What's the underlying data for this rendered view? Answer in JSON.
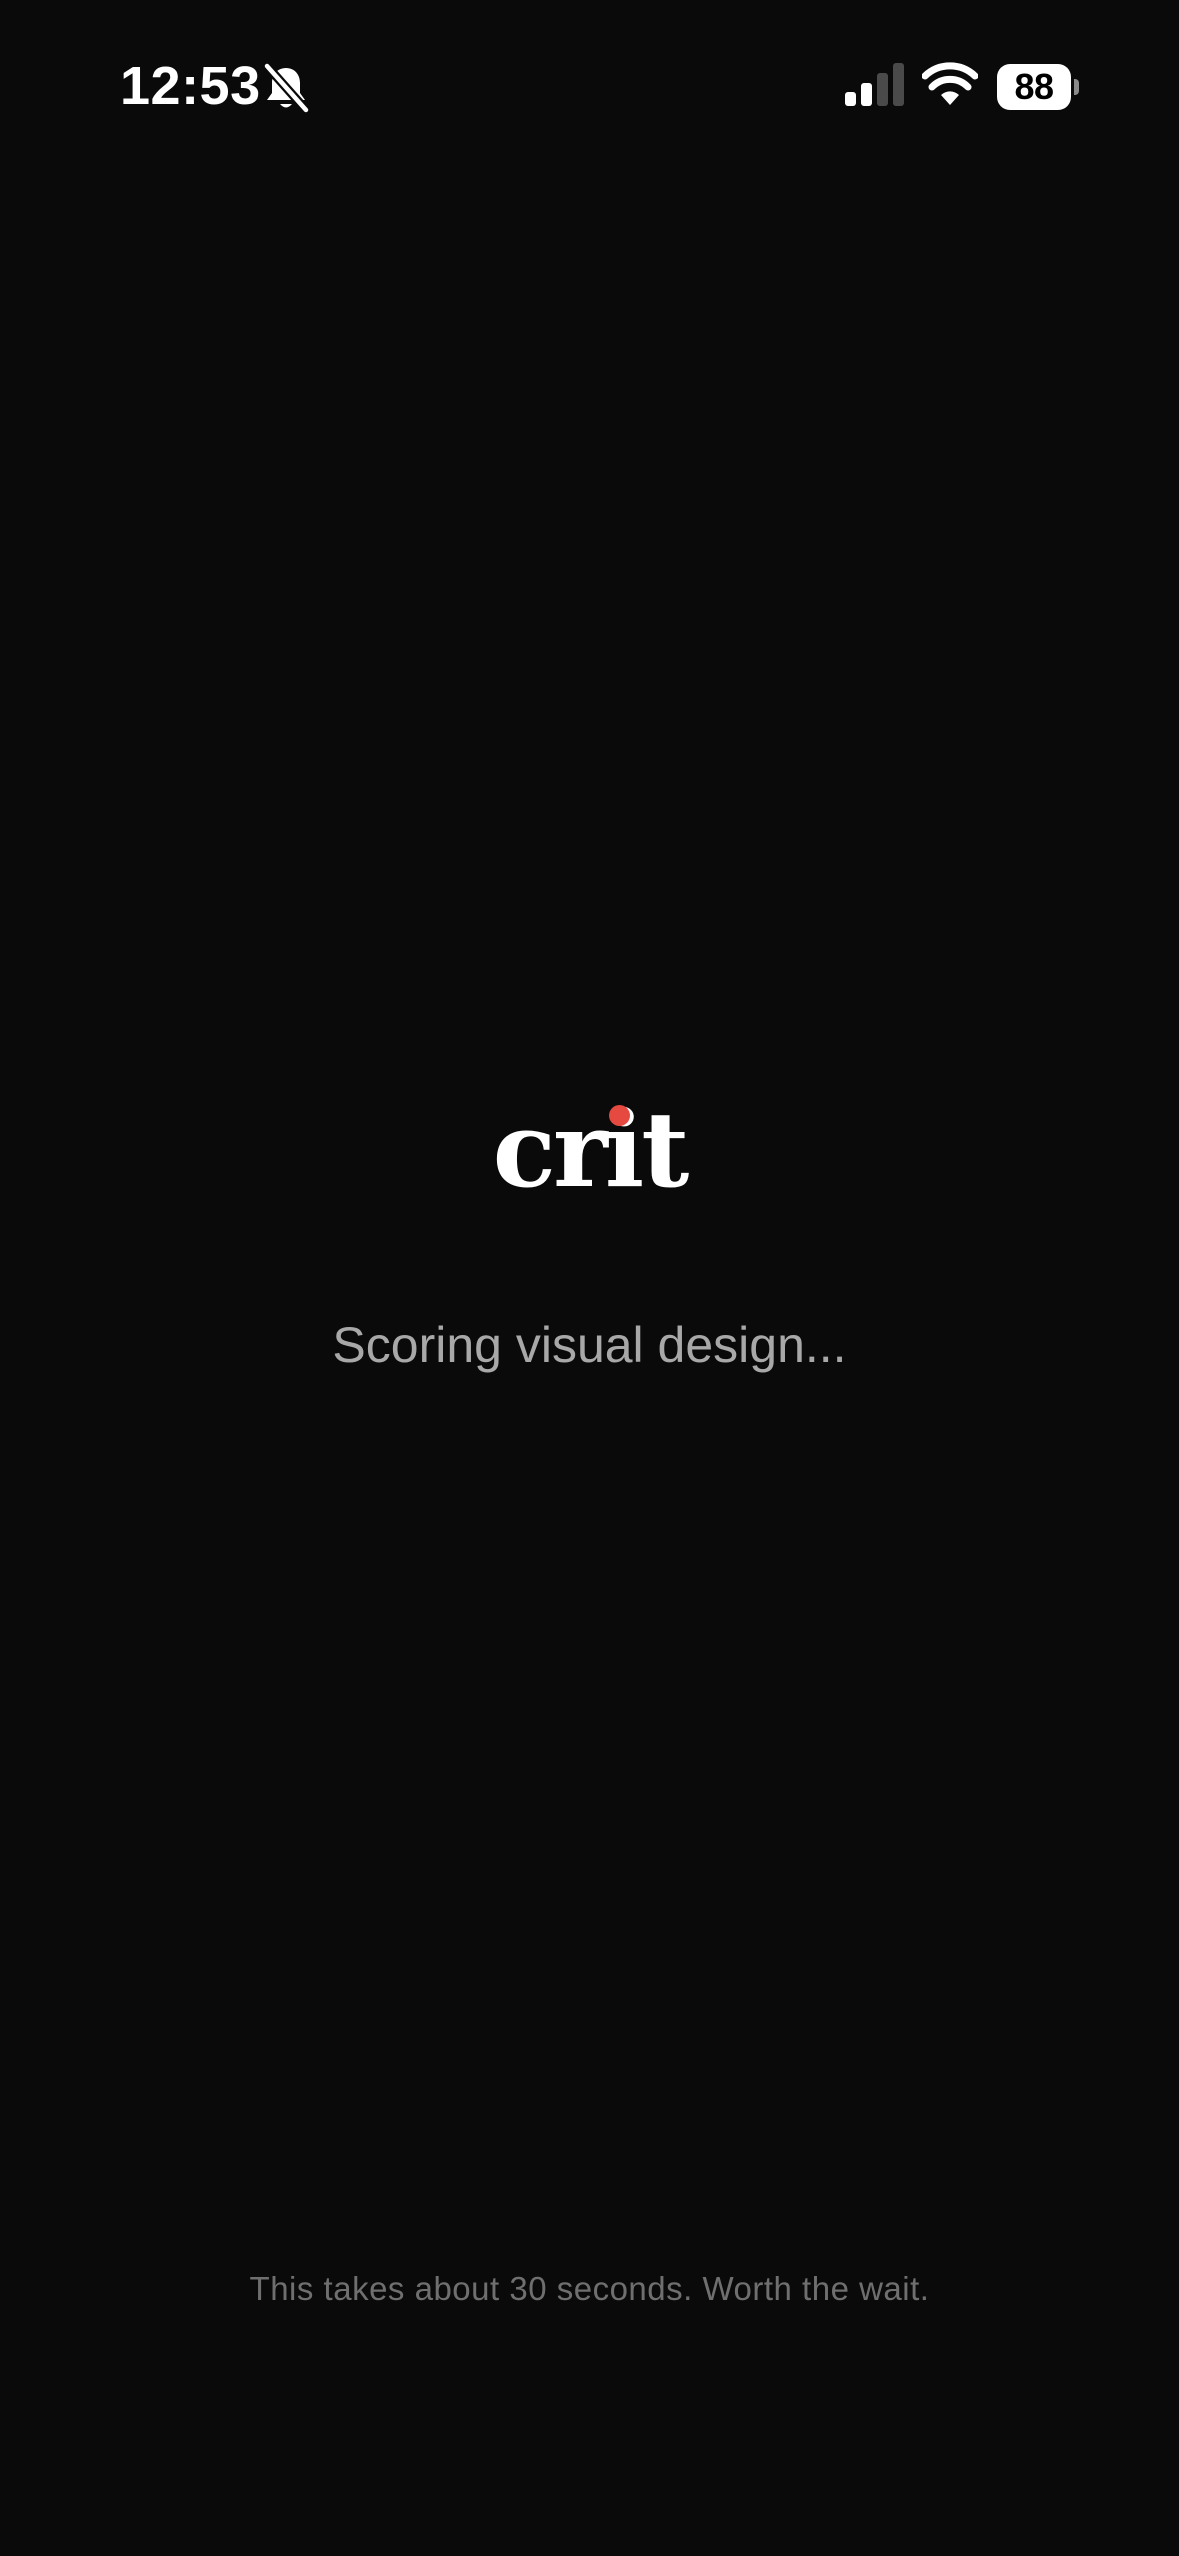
{
  "status_bar": {
    "time": "12:53",
    "silent_icon": "bell-slash-icon",
    "signal_icon": "cellular-signal-icon",
    "wifi_icon": "wifi-icon",
    "battery_level": "88"
  },
  "logo": {
    "text": "crit",
    "accent_color": "#e5493f"
  },
  "loading": {
    "message": "Scoring visual design...",
    "note": "This takes about 30 seconds. Worth the wait."
  },
  "colors": {
    "background": "#0a0a0a",
    "message": "#a8a8a8",
    "note": "#6f6f6f"
  }
}
